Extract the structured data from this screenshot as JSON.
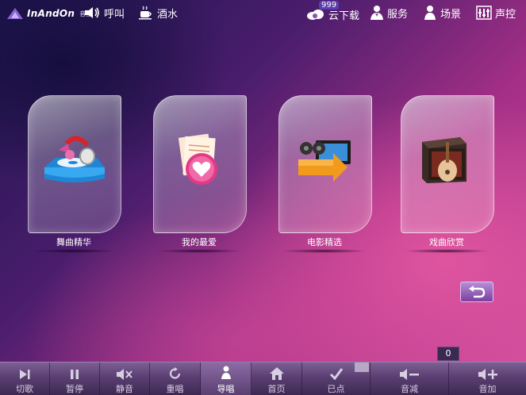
{
  "header": {
    "logo_text": "InAndOn",
    "logo_sub": "音王",
    "call_label": "呼叫",
    "drinks_label": "酒水",
    "download_label": "云下载",
    "download_badge": "999",
    "service_label": "服务",
    "scene_label": "场景",
    "voice_label": "声控"
  },
  "categories": [
    {
      "label": "舞曲精华",
      "icon": "turntable-headphones-icon"
    },
    {
      "label": "我的最爱",
      "icon": "heart-papers-icon"
    },
    {
      "label": "电影精选",
      "icon": "film-reel-icon"
    },
    {
      "label": "戏曲欣赏",
      "icon": "pipa-box-icon"
    }
  ],
  "counter": "0",
  "toolbar": {
    "items": [
      {
        "label": "切歌",
        "icon": "skip-icon"
      },
      {
        "label": "暂停",
        "icon": "pause-icon"
      },
      {
        "label": "静音",
        "icon": "mute-icon"
      },
      {
        "label": "重唱",
        "icon": "replay-icon"
      },
      {
        "label": "导唱",
        "icon": "guide-vocal-icon"
      },
      {
        "label": "首页",
        "icon": "home-icon"
      },
      {
        "label": "已点",
        "icon": "check-icon"
      },
      {
        "label": "音减",
        "icon": "volume-down-icon"
      },
      {
        "label": "音加",
        "icon": "volume-up-icon"
      }
    ]
  },
  "colors": {
    "accent": "#d24f9e",
    "background_dark": "#1e1550",
    "toolbar": "#5a3f72"
  }
}
